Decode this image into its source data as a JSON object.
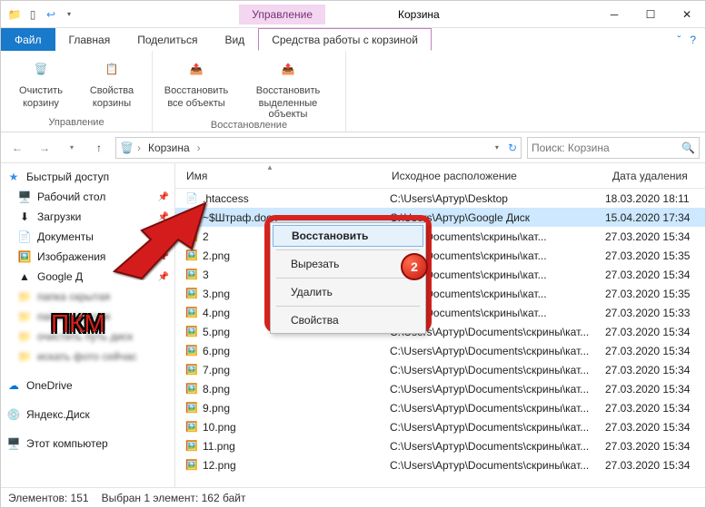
{
  "window": {
    "title": "Корзина",
    "manageTab": "Управление"
  },
  "tabs": {
    "file": "Файл",
    "main": "Главная",
    "share": "Поделиться",
    "view": "Вид",
    "tools": "Средства работы с корзиной"
  },
  "ribbon": {
    "group1": {
      "label": "Управление",
      "btn1a": "Очистить",
      "btn1b": "корзину",
      "btn2a": "Свойства",
      "btn2b": "корзины"
    },
    "group2": {
      "label": "Восстановление",
      "btn1a": "Восстановить",
      "btn1b": "все объекты",
      "btn2a": "Восстановить",
      "btn2b": "выделенные объекты"
    }
  },
  "address": {
    "crumb": "Корзина"
  },
  "search": {
    "placeholder": "Поиск: Корзина"
  },
  "sidebar": {
    "quick": "Быстрый доступ",
    "items": [
      {
        "icon": "🖥️",
        "label": "Рабочий стол",
        "pin": true
      },
      {
        "icon": "⬇",
        "label": "Загрузки",
        "pin": true
      },
      {
        "icon": "📄",
        "label": "Документы",
        "pin": true
      },
      {
        "icon": "🖼️",
        "label": "Изображения",
        "pin": true
      },
      {
        "icon": "▲",
        "label": "Google Д",
        "pin": true
      },
      {
        "icon": "📁",
        "label": "папка скрытая",
        "pin": false
      },
      {
        "icon": "📁",
        "label": "папка скрытая",
        "pin": false
      },
      {
        "icon": "📁",
        "label": "очистить путь диск",
        "pin": false
      },
      {
        "icon": "📁",
        "label": "искать фото сейчас",
        "pin": false
      }
    ],
    "onedrive": "OneDrive",
    "yandex": "Яндекс.Диск",
    "thispc": "Этот компьютер"
  },
  "columns": {
    "name": "Имя",
    "orig": "Исходное расположение",
    "date": "Дата удаления"
  },
  "files": [
    {
      "icon": "📄",
      "name": ".htaccess",
      "orig": "C:\\Users\\Артур\\Desktop",
      "date": "18.03.2020 18:11",
      "sel": false
    },
    {
      "icon": "📘",
      "name": "~$Штраф.docx",
      "orig": "C:\\Users\\Артур\\Google Диск",
      "date": "15.04.2020 17:34",
      "sel": true
    },
    {
      "icon": "🖼️",
      "name": "2",
      "orig": "\\Артур\\Documents\\скрины\\кат...",
      "date": "27.03.2020 15:34",
      "sel": false
    },
    {
      "icon": "🖼️",
      "name": "2.png",
      "orig": "\\Артур\\Documents\\скрины\\кат...",
      "date": "27.03.2020 15:35",
      "sel": false
    },
    {
      "icon": "🖼️",
      "name": "3",
      "orig": "\\Артур\\Documents\\скрины\\кат...",
      "date": "27.03.2020 15:34",
      "sel": false
    },
    {
      "icon": "🖼️",
      "name": "3.png",
      "orig": "\\Артур\\Documents\\скрины\\кат...",
      "date": "27.03.2020 15:35",
      "sel": false
    },
    {
      "icon": "🖼️",
      "name": "4.png",
      "orig": "\\Артур\\Documents\\скрины\\кат...",
      "date": "27.03.2020 15:33",
      "sel": false
    },
    {
      "icon": "🖼️",
      "name": "5.png",
      "orig": "C:\\Users\\Артур\\Documents\\скрины\\кат...",
      "date": "27.03.2020 15:34",
      "sel": false
    },
    {
      "icon": "🖼️",
      "name": "6.png",
      "orig": "C:\\Users\\Артур\\Documents\\скрины\\кат...",
      "date": "27.03.2020 15:34",
      "sel": false
    },
    {
      "icon": "🖼️",
      "name": "7.png",
      "orig": "C:\\Users\\Артур\\Documents\\скрины\\кат...",
      "date": "27.03.2020 15:34",
      "sel": false
    },
    {
      "icon": "🖼️",
      "name": "8.png",
      "orig": "C:\\Users\\Артур\\Documents\\скрины\\кат...",
      "date": "27.03.2020 15:34",
      "sel": false
    },
    {
      "icon": "🖼️",
      "name": "9.png",
      "orig": "C:\\Users\\Артур\\Documents\\скрины\\кат...",
      "date": "27.03.2020 15:34",
      "sel": false
    },
    {
      "icon": "🖼️",
      "name": "10.png",
      "orig": "C:\\Users\\Артур\\Documents\\скрины\\кат...",
      "date": "27.03.2020 15:34",
      "sel": false
    },
    {
      "icon": "🖼️",
      "name": "11.png",
      "orig": "C:\\Users\\Артур\\Documents\\скрины\\кат...",
      "date": "27.03.2020 15:34",
      "sel": false
    },
    {
      "icon": "🖼️",
      "name": "12.png",
      "orig": "C:\\Users\\Артур\\Documents\\скрины\\кат...",
      "date": "27.03.2020 15:34",
      "sel": false
    }
  ],
  "context": {
    "restore": "Восстановить",
    "cut": "Вырезать",
    "delete": "Удалить",
    "props": "Свойства"
  },
  "status": {
    "count": "Элементов: 151",
    "selected": "Выбран 1 элемент: 162 байт"
  },
  "annotation": {
    "badge": "2",
    "pkm": "ПКМ"
  }
}
